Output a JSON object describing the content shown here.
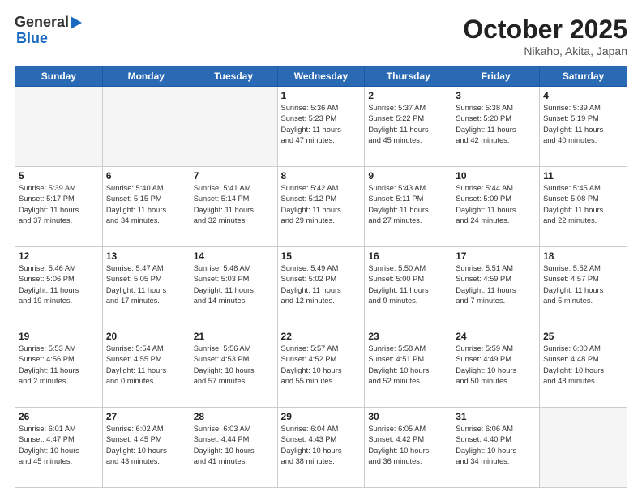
{
  "header": {
    "logo_line1": "General",
    "logo_line2": "Blue",
    "month": "October 2025",
    "location": "Nikaho, Akita, Japan"
  },
  "weekdays": [
    "Sunday",
    "Monday",
    "Tuesday",
    "Wednesday",
    "Thursday",
    "Friday",
    "Saturday"
  ],
  "weeks": [
    [
      {
        "day": "",
        "info": ""
      },
      {
        "day": "",
        "info": ""
      },
      {
        "day": "",
        "info": ""
      },
      {
        "day": "1",
        "info": "Sunrise: 5:36 AM\nSunset: 5:23 PM\nDaylight: 11 hours\nand 47 minutes."
      },
      {
        "day": "2",
        "info": "Sunrise: 5:37 AM\nSunset: 5:22 PM\nDaylight: 11 hours\nand 45 minutes."
      },
      {
        "day": "3",
        "info": "Sunrise: 5:38 AM\nSunset: 5:20 PM\nDaylight: 11 hours\nand 42 minutes."
      },
      {
        "day": "4",
        "info": "Sunrise: 5:39 AM\nSunset: 5:19 PM\nDaylight: 11 hours\nand 40 minutes."
      }
    ],
    [
      {
        "day": "5",
        "info": "Sunrise: 5:39 AM\nSunset: 5:17 PM\nDaylight: 11 hours\nand 37 minutes."
      },
      {
        "day": "6",
        "info": "Sunrise: 5:40 AM\nSunset: 5:15 PM\nDaylight: 11 hours\nand 34 minutes."
      },
      {
        "day": "7",
        "info": "Sunrise: 5:41 AM\nSunset: 5:14 PM\nDaylight: 11 hours\nand 32 minutes."
      },
      {
        "day": "8",
        "info": "Sunrise: 5:42 AM\nSunset: 5:12 PM\nDaylight: 11 hours\nand 29 minutes."
      },
      {
        "day": "9",
        "info": "Sunrise: 5:43 AM\nSunset: 5:11 PM\nDaylight: 11 hours\nand 27 minutes."
      },
      {
        "day": "10",
        "info": "Sunrise: 5:44 AM\nSunset: 5:09 PM\nDaylight: 11 hours\nand 24 minutes."
      },
      {
        "day": "11",
        "info": "Sunrise: 5:45 AM\nSunset: 5:08 PM\nDaylight: 11 hours\nand 22 minutes."
      }
    ],
    [
      {
        "day": "12",
        "info": "Sunrise: 5:46 AM\nSunset: 5:06 PM\nDaylight: 11 hours\nand 19 minutes."
      },
      {
        "day": "13",
        "info": "Sunrise: 5:47 AM\nSunset: 5:05 PM\nDaylight: 11 hours\nand 17 minutes."
      },
      {
        "day": "14",
        "info": "Sunrise: 5:48 AM\nSunset: 5:03 PM\nDaylight: 11 hours\nand 14 minutes."
      },
      {
        "day": "15",
        "info": "Sunrise: 5:49 AM\nSunset: 5:02 PM\nDaylight: 11 hours\nand 12 minutes."
      },
      {
        "day": "16",
        "info": "Sunrise: 5:50 AM\nSunset: 5:00 PM\nDaylight: 11 hours\nand 9 minutes."
      },
      {
        "day": "17",
        "info": "Sunrise: 5:51 AM\nSunset: 4:59 PM\nDaylight: 11 hours\nand 7 minutes."
      },
      {
        "day": "18",
        "info": "Sunrise: 5:52 AM\nSunset: 4:57 PM\nDaylight: 11 hours\nand 5 minutes."
      }
    ],
    [
      {
        "day": "19",
        "info": "Sunrise: 5:53 AM\nSunset: 4:56 PM\nDaylight: 11 hours\nand 2 minutes."
      },
      {
        "day": "20",
        "info": "Sunrise: 5:54 AM\nSunset: 4:55 PM\nDaylight: 11 hours\nand 0 minutes."
      },
      {
        "day": "21",
        "info": "Sunrise: 5:56 AM\nSunset: 4:53 PM\nDaylight: 10 hours\nand 57 minutes."
      },
      {
        "day": "22",
        "info": "Sunrise: 5:57 AM\nSunset: 4:52 PM\nDaylight: 10 hours\nand 55 minutes."
      },
      {
        "day": "23",
        "info": "Sunrise: 5:58 AM\nSunset: 4:51 PM\nDaylight: 10 hours\nand 52 minutes."
      },
      {
        "day": "24",
        "info": "Sunrise: 5:59 AM\nSunset: 4:49 PM\nDaylight: 10 hours\nand 50 minutes."
      },
      {
        "day": "25",
        "info": "Sunrise: 6:00 AM\nSunset: 4:48 PM\nDaylight: 10 hours\nand 48 minutes."
      }
    ],
    [
      {
        "day": "26",
        "info": "Sunrise: 6:01 AM\nSunset: 4:47 PM\nDaylight: 10 hours\nand 45 minutes."
      },
      {
        "day": "27",
        "info": "Sunrise: 6:02 AM\nSunset: 4:45 PM\nDaylight: 10 hours\nand 43 minutes."
      },
      {
        "day": "28",
        "info": "Sunrise: 6:03 AM\nSunset: 4:44 PM\nDaylight: 10 hours\nand 41 minutes."
      },
      {
        "day": "29",
        "info": "Sunrise: 6:04 AM\nSunset: 4:43 PM\nDaylight: 10 hours\nand 38 minutes."
      },
      {
        "day": "30",
        "info": "Sunrise: 6:05 AM\nSunset: 4:42 PM\nDaylight: 10 hours\nand 36 minutes."
      },
      {
        "day": "31",
        "info": "Sunrise: 6:06 AM\nSunset: 4:40 PM\nDaylight: 10 hours\nand 34 minutes."
      },
      {
        "day": "",
        "info": ""
      }
    ]
  ]
}
